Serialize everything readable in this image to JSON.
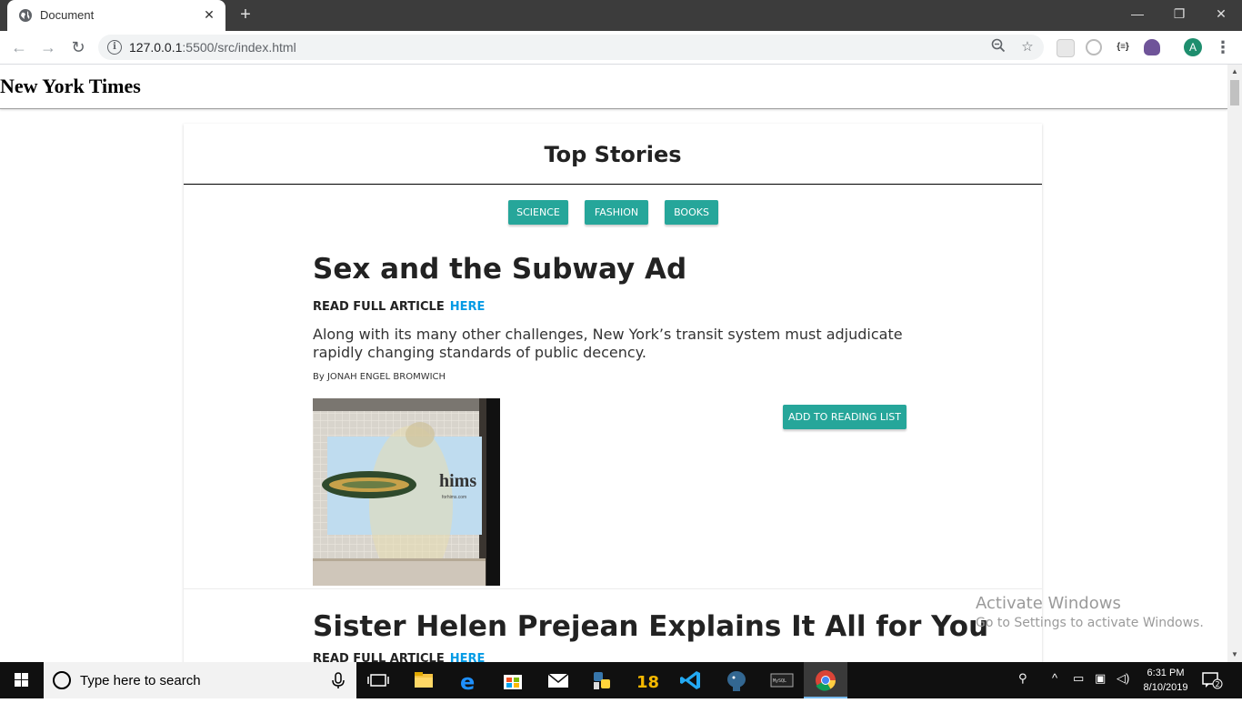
{
  "browser": {
    "tab_title": "Document",
    "tab_close": "✕",
    "new_tab": "+",
    "url_host": "127.0.0.1",
    "url_rest": ":5500/src/index.html",
    "avatar_letter": "A",
    "window_controls": {
      "minimize": "—",
      "restore": "❐",
      "close": "✕"
    }
  },
  "site": {
    "title": "New York Times"
  },
  "stories": {
    "heading": "Top Stories",
    "filters": [
      "SCIENCE",
      "FASHION",
      "BOOKS"
    ],
    "articles": [
      {
        "title": "Sex and the Subway Ad",
        "read_label": "READ FULL ARTICLE",
        "link_label": "HERE",
        "abstract": "Along with its many other challenges, New York’s transit system must adjudicate rapidly changing standards of public decency.",
        "byline": "By JONAH ENGEL BROMWICH",
        "add_button": "ADD TO READING LIST",
        "image_text": "hims",
        "image_subtext": "forhims.com"
      },
      {
        "title": "Sister Helen Prejean Explains It All for You",
        "read_label": "READ FULL ARTICLE",
        "link_label": "HERE"
      }
    ]
  },
  "watermark": {
    "title": "Activate Windows",
    "subtitle": "Go to Settings to activate Windows."
  },
  "taskbar": {
    "search_placeholder": "Type here to search",
    "clock_time": "6:31 PM",
    "clock_date": "8/10/2019",
    "notification_count": "2",
    "badge_18": "18"
  },
  "colors": {
    "accent": "#26a69a",
    "link": "#039be5",
    "chrome_dark": "#3c3c3c"
  }
}
